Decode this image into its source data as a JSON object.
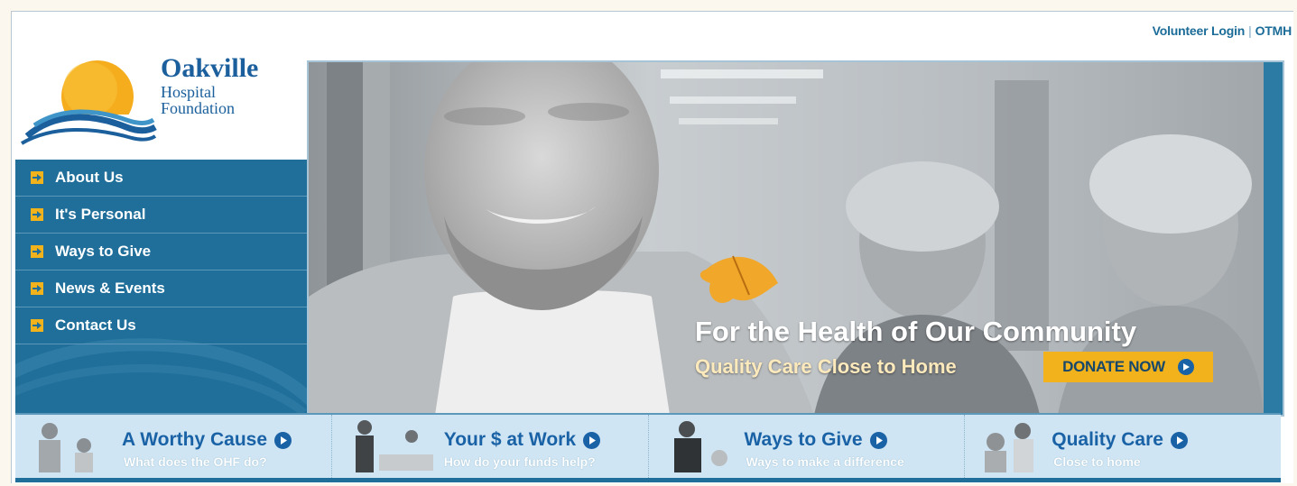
{
  "top_links": {
    "volunteer_login": "Volunteer Login",
    "separator": "|",
    "otmh": "OTMH"
  },
  "logo": {
    "line1": "Oakville",
    "line2": "Hospital",
    "line3": "Foundation"
  },
  "nav": {
    "items": [
      {
        "label": "About Us"
      },
      {
        "label": "It's Personal"
      },
      {
        "label": "Ways to Give"
      },
      {
        "label": "News & Events"
      },
      {
        "label": "Contact Us"
      }
    ]
  },
  "hero": {
    "headline": "For the Health of Our Community",
    "subheadline": "Quality Care Close to Home",
    "donate_label": "DONATE NOW"
  },
  "tiles": [
    {
      "title": "A Worthy Cause",
      "subtitle": "What does the OHF do?"
    },
    {
      "title": "Your $ at Work",
      "subtitle": "How do your funds help?"
    },
    {
      "title": "Ways to Give",
      "subtitle": "Ways to make a difference"
    },
    {
      "title": "Quality Care",
      "subtitle": "Close to home"
    }
  ],
  "colors": {
    "nav_blue": "#1f6f9a",
    "accent_yellow": "#f2b21b",
    "link_blue": "#1b6c98",
    "strip_bg": "#cfe5f3"
  },
  "icons": {
    "nav_bullet": "arrow-right-icon",
    "circle_arrow": "circle-arrow-right-icon"
  }
}
